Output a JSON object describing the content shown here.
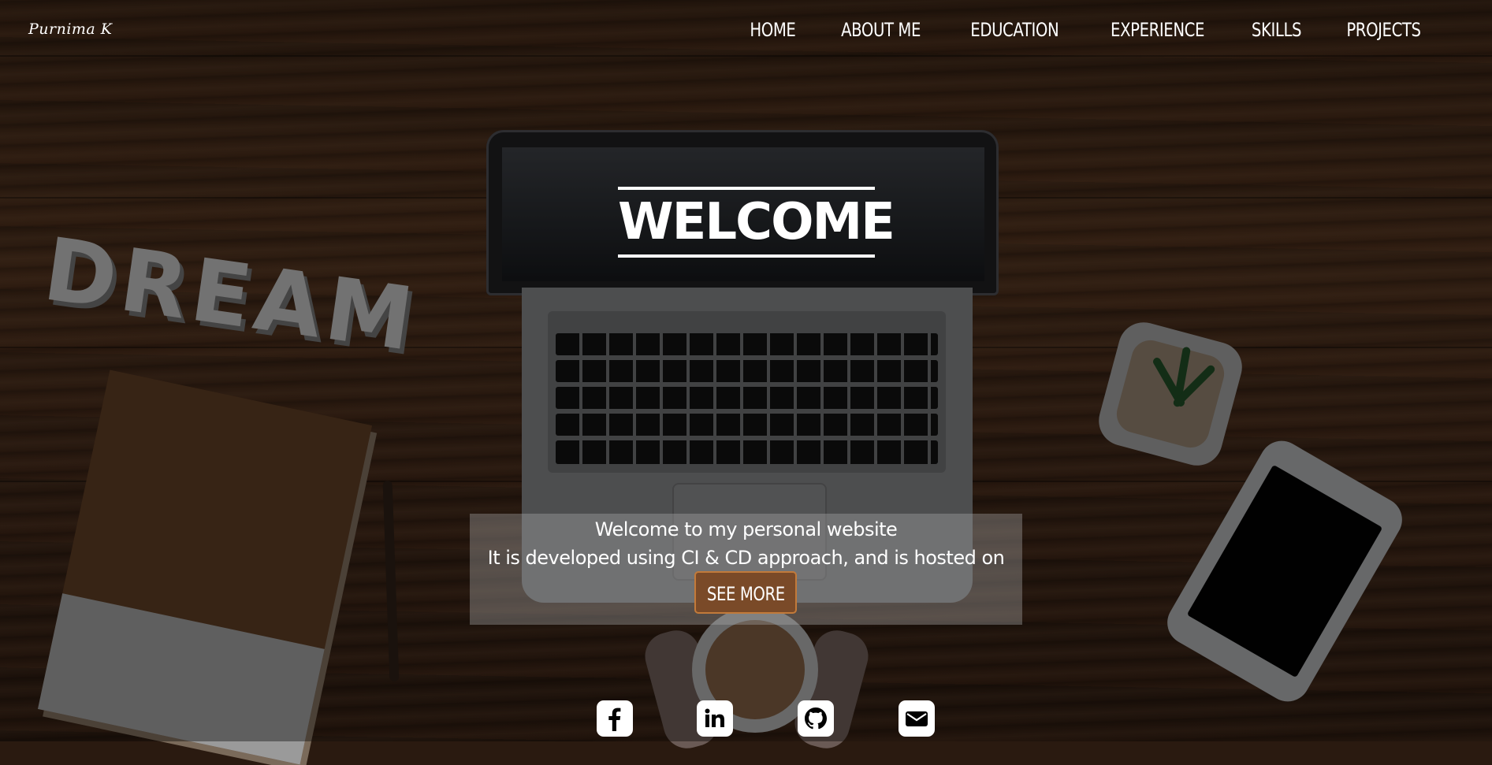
{
  "brand": "Purnima K",
  "nav": {
    "items": [
      "HOME",
      "ABOUT ME",
      "EDUCATION",
      "EXPERIENCE",
      "SKILLS",
      "PROJECTS"
    ]
  },
  "hero": {
    "title": "WELCOME",
    "line1": "Welcome to my personal website",
    "line2": "It is developed using CI & CD approach, and is hosted on AWS EC2",
    "button": "SEE MORE"
  },
  "social_icons": [
    "facebook-icon",
    "linkedin-icon",
    "github-icon",
    "email-icon"
  ],
  "colors": {
    "button_bg": "#7a4a28",
    "button_border": "#c27a3a",
    "text": "#ffffff"
  }
}
